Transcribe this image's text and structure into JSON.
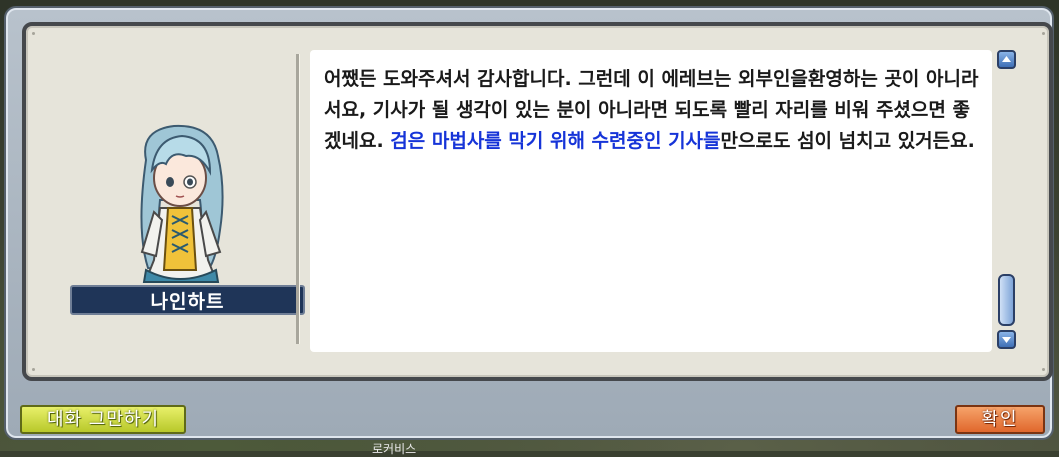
{
  "npc": {
    "name": "나인하트"
  },
  "dialog": {
    "text_before": "어쨌든 도와주셔서 감사합니다. 그런데 이 에레브는 외부인을환영하는 곳이 아니라서요, 기사가 될 생각이 있는 분이 아니라면 되도록 빨리 자리를 비워 주셨으면 좋겠네요. ",
    "highlight": "검은 마법사를 막기 위해 수련중인 기사들",
    "text_after": "만으로도 섬이 넘치고 있거든요."
  },
  "buttons": {
    "end_chat": "대화 그만하기",
    "confirm": "확인"
  },
  "background": {
    "partial_text": "로커비스"
  },
  "colors": {
    "highlight_text": "#1634d8",
    "name_plate": "#1f3558",
    "end_button": "#d4e040",
    "confirm_button": "#ee8446",
    "scroll_button": "#5b88c8"
  }
}
